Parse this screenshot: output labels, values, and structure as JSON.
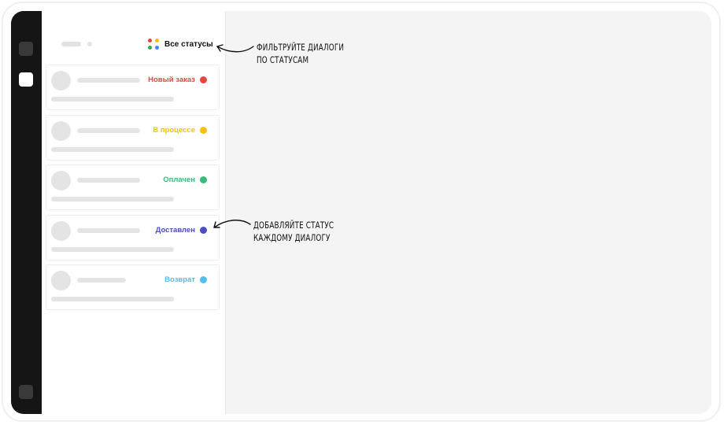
{
  "filter": {
    "label": "Все статусы",
    "icon": "colored-dots-grid-icon",
    "icon_colors": [
      "#ea4335",
      "#fbbc05",
      "#34a853",
      "#4285f4"
    ]
  },
  "dialogs": [
    {
      "status": "Новый заказ",
      "color": "#e8453c"
    },
    {
      "status": "В процессе",
      "color": "#f4c20d"
    },
    {
      "status": "Оплачен",
      "color": "#3cba7a"
    },
    {
      "status": "Доставлен",
      "color": "#4a4fc4"
    },
    {
      "status": "Возврат",
      "color": "#52bff0"
    }
  ],
  "annotations": {
    "filter_hint_line1": "ФИЛЬТРУЙТЕ ДИАЛОГИ",
    "filter_hint_line2": "ПО СТАТУСАМ",
    "status_hint_line1": "ДОБАВЛЯЙТЕ СТАТУС",
    "status_hint_line2": "КАЖДОМУ ДИАЛОГУ"
  }
}
